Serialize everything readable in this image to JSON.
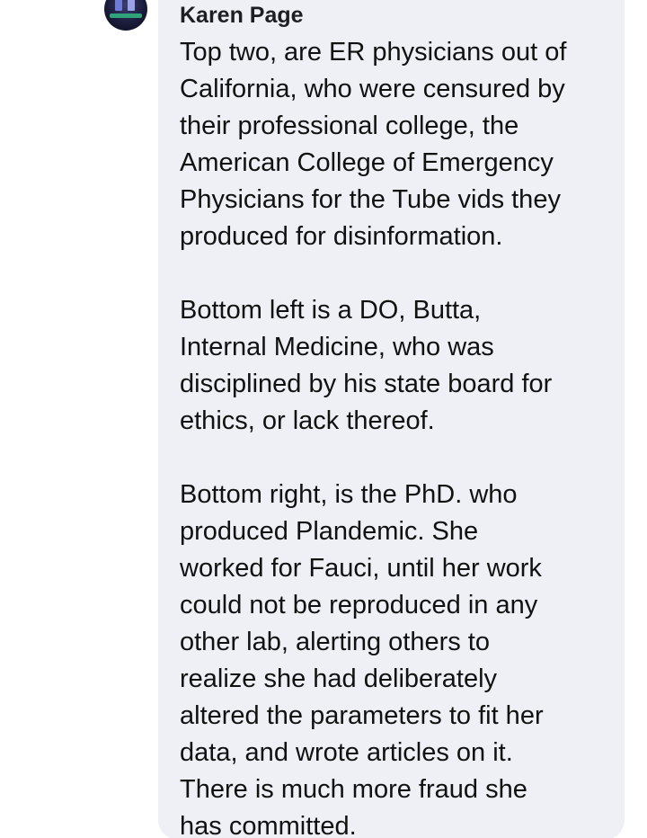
{
  "comment": {
    "author": "Karen Page",
    "avatar_icon": "user-avatar-icon",
    "paragraphs": [
      "Top two, are ER physicians out of\nCalifornia, who were censured by\ntheir professional college, the\nAmerican College of Emergency\nPhysicians for the Tube vids they\nproduced for disinformation.",
      "Bottom left is a DO,  Butta,\nInternal Medicine, who was\ndisciplined by his state board for\nethics, or lack thereof.",
      "Bottom right, is the PhD. who\nproduced Plandemic. She\nworked for Fauci, until her work\ncould not be reproduced in any\nother lab, alerting others to\nrealize she had deliberately\naltered  the parameters to fit  her\ndata, and wrote articles on it.\nThere is much more fraud she\nhas committed."
    ]
  },
  "colors": {
    "bubble_background": "#eff0f5",
    "text": "#111111",
    "author_text": "#1c1e21"
  }
}
